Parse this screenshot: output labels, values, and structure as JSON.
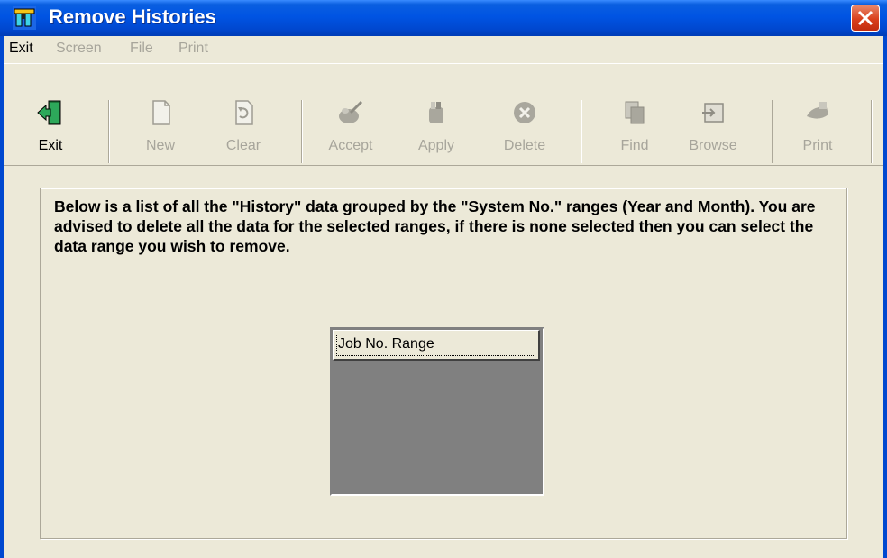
{
  "window": {
    "title": "Remove Histories",
    "icon": "binoculars-icon",
    "close_icon": "close-icon"
  },
  "menu": {
    "items": [
      {
        "label": "Exit",
        "enabled": true
      },
      {
        "label": "Screen",
        "enabled": false
      },
      {
        "label": "File",
        "enabled": false
      },
      {
        "label": "Print",
        "enabled": false
      }
    ]
  },
  "toolbar": {
    "buttons": [
      {
        "label": "Exit",
        "icon": "exit-door-icon",
        "enabled": true
      },
      {
        "label": "New",
        "icon": "new-page-icon",
        "enabled": false
      },
      {
        "label": "Clear",
        "icon": "clear-icon",
        "enabled": false
      },
      {
        "label": "Accept",
        "icon": "accept-icon",
        "enabled": false
      },
      {
        "label": "Apply",
        "icon": "apply-icon",
        "enabled": false
      },
      {
        "label": "Delete",
        "icon": "delete-icon",
        "enabled": false
      },
      {
        "label": "Find",
        "icon": "find-icon",
        "enabled": false
      },
      {
        "label": "Browse",
        "icon": "browse-icon",
        "enabled": false
      },
      {
        "label": "Print",
        "icon": "print-icon",
        "enabled": false
      }
    ]
  },
  "content": {
    "description": "Below is a list of all the \"History\" data grouped by the \"System No.\" ranges (Year and Month). You are advised to delete all the data for the selected ranges, if there is none selected then you can select the data range you wish to remove.",
    "list": {
      "column_header": "Job No. Range",
      "rows": []
    }
  },
  "colors": {
    "titlebar": "#0054E3",
    "window_bg": "#ECE9D8",
    "disabled_text": "#A7A59B",
    "list_bg": "#808080"
  }
}
